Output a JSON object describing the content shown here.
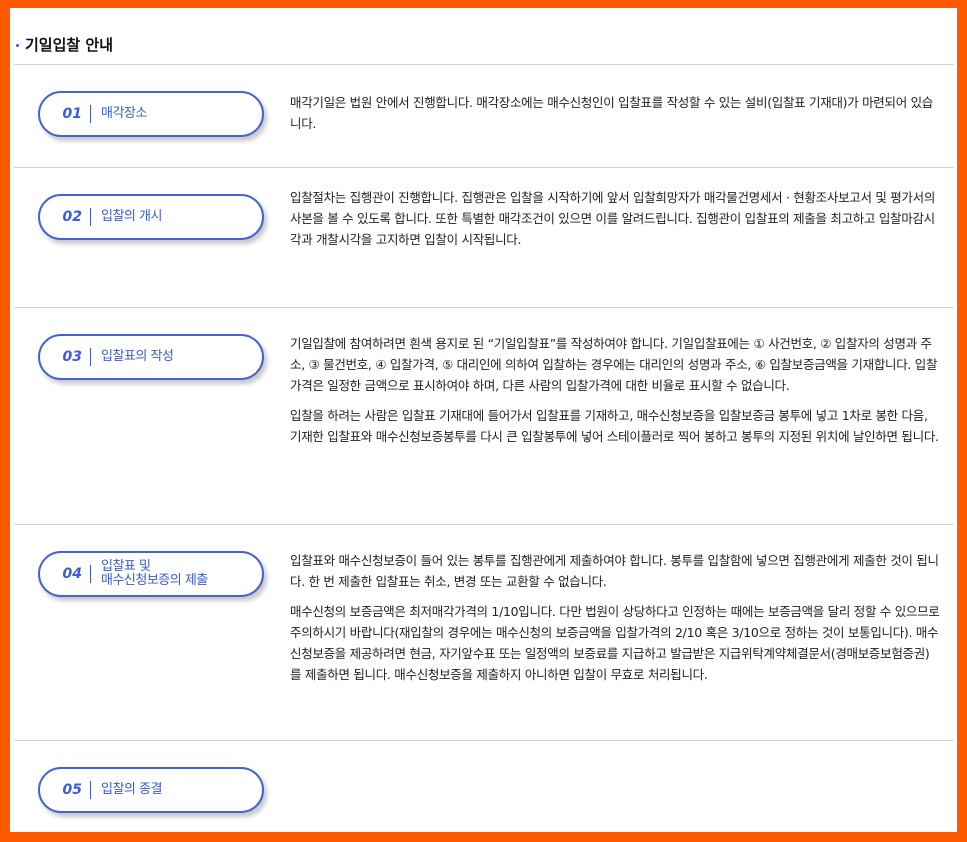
{
  "page": {
    "title": "기일입찰 안내"
  },
  "steps": [
    {
      "num": "01",
      "label": "매각장소",
      "paragraphs": [
        "매각기일은 법원 안에서 진행합니다. 매각장소에는 매수신청인이 입찰표를 작성할 수 있는 설비(입찰표 기재대)가 마련되어 있습니다."
      ]
    },
    {
      "num": "02",
      "label": "입찰의 개시",
      "paragraphs": [
        "입찰절차는 집행관이 진행합니다. 집행관은 입찰을 시작하기에 앞서 입찰희망자가 매각물건명세서 · 현황조사보고서 및 평가서의 사본을 볼 수 있도록 합니다. 또한 특별한 매각조건이 있으면 이를 알려드립니다. 집행관이 입찰표의 제출을 최고하고 입찰마감시각과 개찰시각을 고지하면 입찰이 시작됩니다."
      ]
    },
    {
      "num": "03",
      "label": "입찰표의 작성",
      "paragraphs": [
        "기일입찰에 참여하려면 흰색 용지로 된 “기일입찰표”를 작성하여야 합니다. 기일입찰표에는 ① 사건번호, ② 입찰자의 성명과 주소, ③ 물건번호, ④ 입찰가격, ⑤ 대리인에 의하여 입찰하는 경우에는 대리인의 성명과 주소, ⑥ 입찰보증금액을 기재합니다. 입찰가격은 일정한 금액으로 표시하여야 하며, 다른 사람의 입찰가격에 대한 비율로 표시할 수 없습니다.",
        "입찰을 하려는 사람은 입찰표 기재대에 들어가서 입찰표를 기재하고, 매수신청보증을 입찰보증금 봉투에 넣고 1차로 봉한 다음, 기재한 입찰표와 매수신청보증봉투를 다시 큰 입찰봉투에 넣어 스테이플러로 찍어 봉하고 봉투의 지정된 위치에 날인하면 됩니다."
      ]
    },
    {
      "num": "04",
      "label": "입찰표 및 매수신청보증의 제출",
      "label_lines": [
        "입찰표 및",
        "매수신청보증의 제출"
      ],
      "paragraphs": [
        "입찰표와 매수신청보증이 들어 있는 봉투를 집행관에게 제출하여야 합니다. 봉투를 입찰함에 넣으면 집행관에게 제출한 것이 됩니다. 한 번 제출한 입찰표는 취소, 변경 또는 교환할 수 없습니다.",
        "매수신청의 보증금액은 최저매각가격의 1/10입니다. 다만 법원이 상당하다고 인정하는 때에는 보증금액을 달리 정할 수 있으므로 주의하시기 바랍니다(재입찰의 경우에는 매수신청의 보증금액을 입찰가격의 2/10 혹은 3/10으로 정하는 것이 보통입니다). 매수신청보증을 제공하려면 현금, 자기앞수표 또는 일정액의 보증료를 지급하고 발급받은 지급위탁계약체결문서(경매보증보험증권)를 제출하면 됩니다. 매수신청보증을 제출하지 아니하면 입찰이 무효로 처리됩니다."
      ]
    },
    {
      "num": "05",
      "label": "입찰의 종결",
      "paragraphs": []
    }
  ],
  "colors": {
    "frame": "#ff5a00",
    "accent": "#3a5bd9"
  }
}
